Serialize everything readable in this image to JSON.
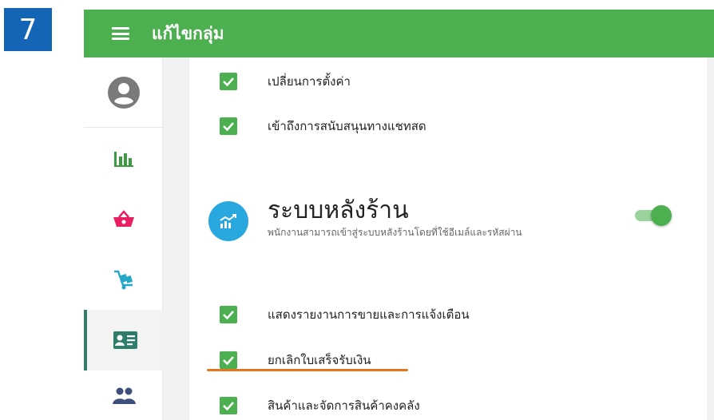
{
  "step": {
    "number": "7"
  },
  "appbar": {
    "title": "แก้ไขกลุ่ม"
  },
  "sidebar": {
    "items": [
      {
        "name": "profile",
        "icon": "account-circle-icon"
      },
      {
        "name": "reports",
        "icon": "bar-chart-icon"
      },
      {
        "name": "sales",
        "icon": "basket-icon"
      },
      {
        "name": "inventory",
        "icon": "cart-dolly-icon"
      },
      {
        "name": "employee-card",
        "icon": "id-card-icon",
        "active": true
      },
      {
        "name": "groups",
        "icon": "people-icon"
      }
    ]
  },
  "permissions_top": [
    {
      "label": "เปลี่ยนการตั้งค่า",
      "checked": true
    },
    {
      "label": "เข้าถึงการสนับสนุนทางแชทสด",
      "checked": true
    }
  ],
  "backoffice": {
    "title": "ระบบหลังร้าน",
    "description": "พนักงานสามารถเข้าสู่ระบบหลังร้านโดยที่ใช้อีเมล์และรหัสผ่าน",
    "enabled": true
  },
  "permissions_bottom": [
    {
      "label": "แสดงรายงานการขายและการแจ้งเตือน",
      "checked": true
    },
    {
      "label": "ยกเลิกใบเสร็จรับเงิน",
      "checked": true
    },
    {
      "label": "สินค้าและจัดการสินค้าคงคลัง",
      "checked": true
    }
  ],
  "colors": {
    "appbar": "#4caf50",
    "step_badge": "#1565b6",
    "checkbox": "#4caf50",
    "highlight": "#e8741e",
    "section_icon": "#29a7df"
  }
}
